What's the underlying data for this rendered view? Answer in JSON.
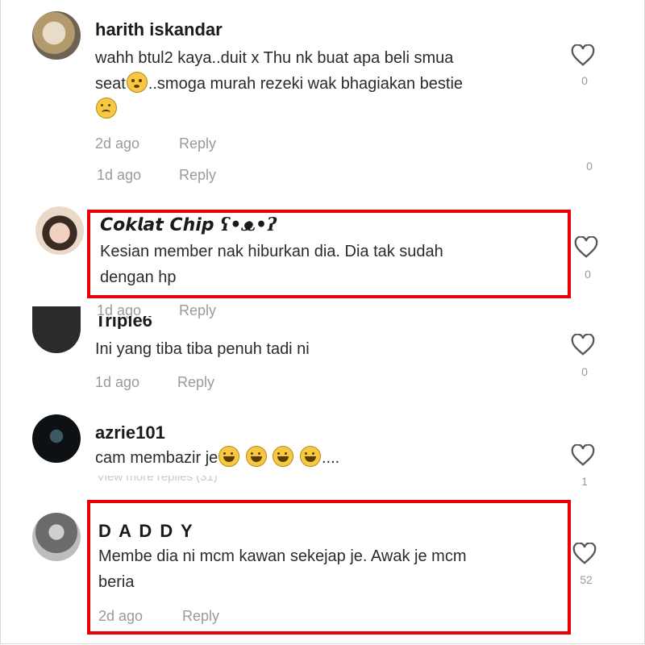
{
  "comments": [
    {
      "username": "harith iskandar",
      "text_line1_a": "wahh btul2 kaya..duit x Thu nk buat apa beli smua",
      "text_line2_a": "seat",
      "text_line2_b": "..smoga murah rezeki wak bhagiakan bestie",
      "time": "2d ago",
      "reply": "Reply",
      "likes": "0",
      "subreply_time": "1d ago",
      "subreply_reply": "Reply",
      "subreply_likes": "0"
    },
    {
      "username": "𝘾𝙤𝙠𝙡𝙖𝙩 𝘾𝙝𝙞𝙥 ʕ•ᴥ•ʔ",
      "text_line1": "Kesian member nak hiburkan dia. Dia tak sudah",
      "text_line2": "dengan hp",
      "likes": "0",
      "time": "1d ago",
      "reply": "Reply"
    },
    {
      "username": "Triple6",
      "text": "Ini yang tiba tiba penuh tadi ni",
      "time": "1d ago",
      "reply": "Reply",
      "likes": "0"
    },
    {
      "username": "azrie101",
      "text": "cam membazir je",
      "text_tail": "....",
      "view_more": "View more replies (31)",
      "likes": "1"
    },
    {
      "username": "D A D D Y",
      "text_line1": "Membe dia ni mcm kawan sekejap je. Awak je mcm",
      "text_line2": "beria",
      "time": "2d ago",
      "reply": "Reply",
      "likes": "52"
    }
  ],
  "icons": {
    "like": "heart-outline-icon",
    "emoji_flushed": "flushed-face-emoji",
    "emoji_sad": "sad-face-emoji",
    "emoji_laugh": "tears-of-joy-emoji"
  },
  "colors": {
    "highlight": "#e8000b",
    "meta": "#9a9a9a"
  }
}
